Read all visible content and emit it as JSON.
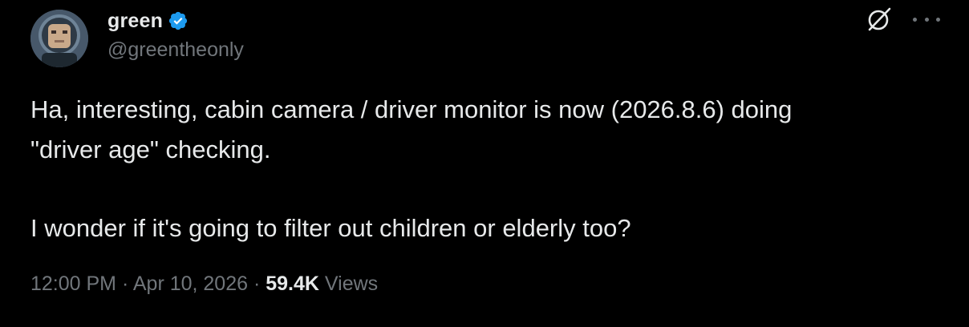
{
  "author": {
    "display_name": "green",
    "handle": "@greentheonly",
    "verified": true
  },
  "tweet": {
    "line1": "Ha, interesting, cabin camera / driver monitor is now (2026.8.6) doing",
    "line2": "\"driver age\" checking.",
    "line3": "I wonder if it's going to filter out children or elderly too?"
  },
  "meta": {
    "time": "12:00 PM",
    "separator1": " · ",
    "date": "Apr 10, 2026",
    "separator2": " · ",
    "views_count": "59.4K",
    "views_label": " Views"
  },
  "icons": {
    "verified": "verified-badge-icon",
    "grok": "grok-icon",
    "more": "more-options-icon"
  },
  "colors": {
    "background": "#000000",
    "text_primary": "#e7e9ea",
    "text_secondary": "#71767b",
    "verified_blue": "#1d9bf0"
  }
}
